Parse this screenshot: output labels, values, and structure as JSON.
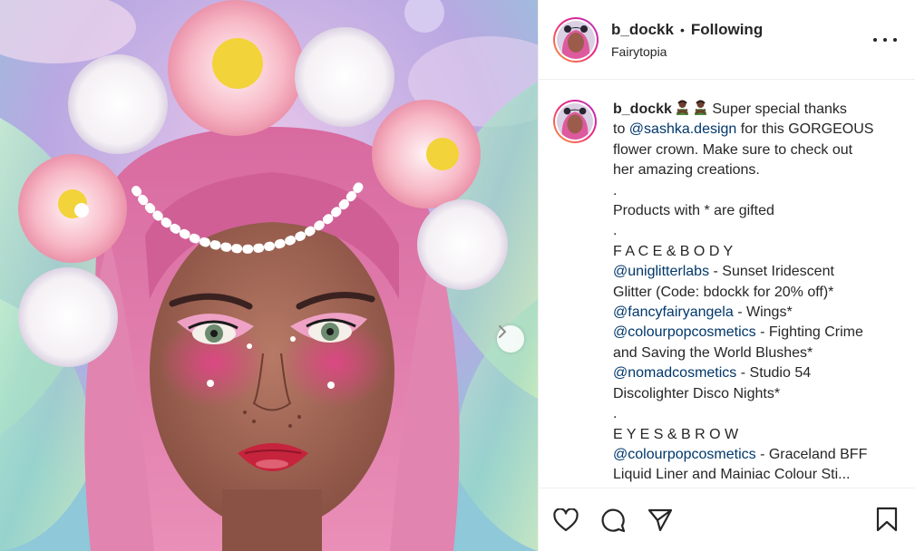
{
  "header": {
    "username": "b_dockk",
    "separator": "•",
    "follow_status": "Following",
    "location": "Fairytopia",
    "more_icon": "more-horizontal-icon"
  },
  "caption": {
    "username": "b_dockk",
    "emojis": [
      "woman-gesturing-no-emoji",
      "woman-gesturing-no-emoji"
    ],
    "lines": [
      {
        "parts": [
          {
            "text": " Super special thanks",
            "type": "text"
          }
        ]
      },
      {
        "parts": [
          {
            "text": "to ",
            "type": "text"
          },
          {
            "text": "@sashka.design",
            "type": "mention"
          },
          {
            "text": " for this GORGEOUS",
            "type": "text"
          }
        ]
      },
      {
        "parts": [
          {
            "text": "flower crown. Make sure to check out",
            "type": "text"
          }
        ]
      },
      {
        "parts": [
          {
            "text": "her amazing creations.",
            "type": "text"
          }
        ]
      },
      {
        "parts": [
          {
            "text": ".",
            "type": "text"
          }
        ]
      },
      {
        "parts": [
          {
            "text": "Products with * are gifted",
            "type": "text"
          }
        ]
      },
      {
        "parts": [
          {
            "text": ".",
            "type": "text"
          }
        ]
      },
      {
        "parts": [
          {
            "text": "F A C E & B O D Y",
            "type": "text"
          }
        ]
      },
      {
        "parts": [
          {
            "text": "@uniglitterlabs",
            "type": "mention"
          },
          {
            "text": " - Sunset Iridescent",
            "type": "text"
          }
        ]
      },
      {
        "parts": [
          {
            "text": "Glitter (Code: bdockk for 20% off)*",
            "type": "text"
          }
        ]
      },
      {
        "parts": [
          {
            "text": "@fancyfairyangela",
            "type": "mention"
          },
          {
            "text": " - Wings*",
            "type": "text"
          }
        ]
      },
      {
        "parts": [
          {
            "text": "@colourpopcosmetics",
            "type": "mention"
          },
          {
            "text": " - Fighting Crime",
            "type": "text"
          }
        ]
      },
      {
        "parts": [
          {
            "text": "and Saving the World Blushes*",
            "type": "text"
          }
        ]
      },
      {
        "parts": [
          {
            "text": "@nomadcosmetics",
            "type": "mention"
          },
          {
            "text": " - Studio 54",
            "type": "text"
          }
        ]
      },
      {
        "parts": [
          {
            "text": "Discolighter Disco Nights*",
            "type": "text"
          }
        ]
      },
      {
        "parts": [
          {
            "text": ".",
            "type": "text"
          }
        ]
      },
      {
        "parts": [
          {
            "text": "E Y E S & B R O W",
            "type": "text"
          }
        ]
      },
      {
        "parts": [
          {
            "text": "@colourpopcosmetics",
            "type": "mention"
          },
          {
            "text": " - Graceland BFF",
            "type": "text"
          }
        ]
      },
      {
        "parts": [
          {
            "text": "Liquid Liner and Mainiac Colour Sti...",
            "type": "text"
          }
        ]
      }
    ]
  },
  "actions": {
    "like_icon": "heart-icon",
    "comment_icon": "comment-icon",
    "share_icon": "paper-plane-icon",
    "save_icon": "bookmark-icon"
  },
  "media": {
    "next_icon": "chevron-right-icon"
  },
  "colors": {
    "text": "#262626",
    "mention": "#00376b",
    "border": "#efefef",
    "ring_start": "#f9a13a",
    "ring_mid": "#ee2a7b",
    "ring_end": "#b62ec3"
  }
}
